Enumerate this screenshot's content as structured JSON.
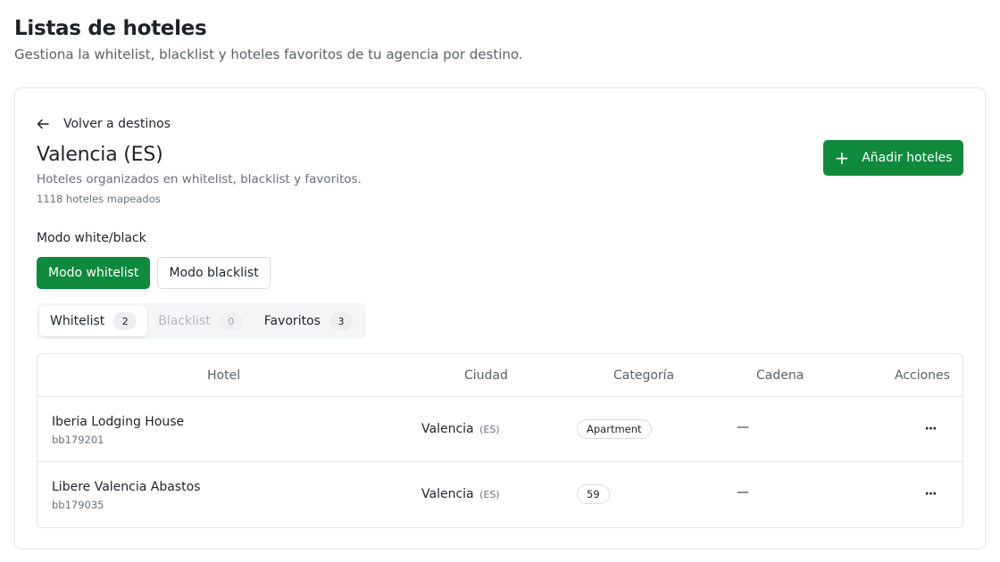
{
  "page": {
    "title": "Listas de hoteles",
    "subtitle": "Gestiona la whitelist, blacklist y hoteles favoritos de tu agencia por destino."
  },
  "destination": {
    "back_label": "Volver a destinos",
    "title": "Valencia (ES)",
    "description": "Hoteles organizados en whitelist, blacklist y favoritos.",
    "mapped_count": "1118 hoteles mapeados",
    "add_button_label": "Añadir hoteles"
  },
  "mode": {
    "label": "Modo white/black",
    "options": [
      {
        "label": "Modo whitelist",
        "active": true
      },
      {
        "label": "Modo blacklist",
        "active": false
      }
    ]
  },
  "tabs": [
    {
      "label": "Whitelist",
      "count": "2",
      "state": "active"
    },
    {
      "label": "Blacklist",
      "count": "0",
      "state": "disabled"
    },
    {
      "label": "Favoritos",
      "count": "3",
      "state": "normal"
    }
  ],
  "table": {
    "headers": {
      "hotel": "Hotel",
      "city": "Ciudad",
      "category": "Categoría",
      "chain": "Cadena",
      "actions": "Acciones"
    },
    "rows": [
      {
        "name": "Iberia Lodging House",
        "code": "bb179201",
        "city": "Valencia",
        "country": "(ES)",
        "category": "Apartment",
        "chain": "—",
        "actions": "···"
      },
      {
        "name": "Libere Valencia Abastos",
        "code": "bb179035",
        "city": "Valencia",
        "country": "(ES)",
        "category": "59",
        "chain": "—",
        "actions": "···"
      }
    ]
  },
  "colors": {
    "primary": "#0f8a3c",
    "border": "#e2e4e7",
    "muted_text": "#6b7178"
  },
  "icons": {
    "back": "arrow-left-icon",
    "add": "plus-icon",
    "row_actions": "more-horizontal-icon"
  }
}
